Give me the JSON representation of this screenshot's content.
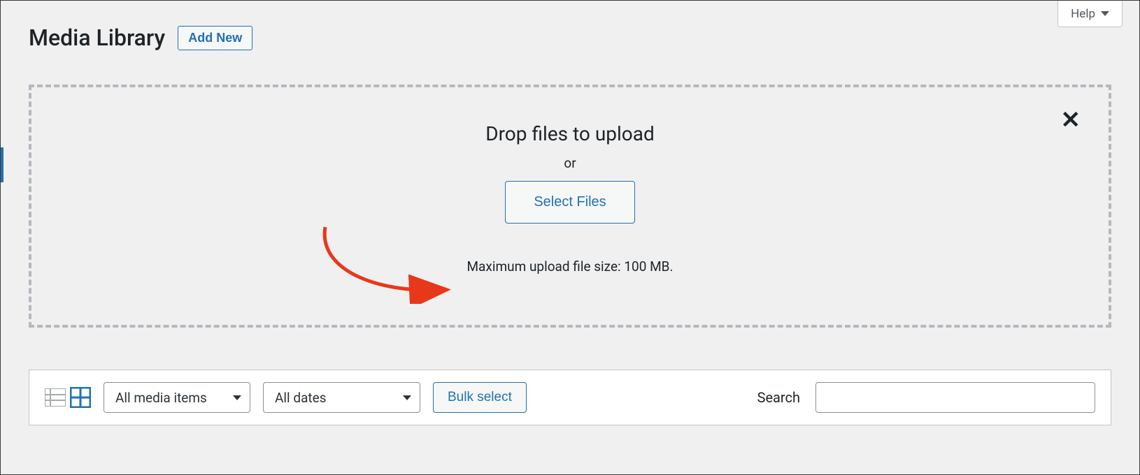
{
  "header": {
    "page_title": "Media Library",
    "add_new_label": "Add New",
    "help_label": "Help"
  },
  "uploader": {
    "drop_title": "Drop files to upload",
    "or_text": "or",
    "select_files_label": "Select Files",
    "max_size_text": "Maximum upload file size: 100 MB."
  },
  "filters": {
    "media_type_selected": "All media items",
    "date_selected": "All dates",
    "bulk_select_label": "Bulk select",
    "search_label": "Search",
    "search_value": ""
  }
}
